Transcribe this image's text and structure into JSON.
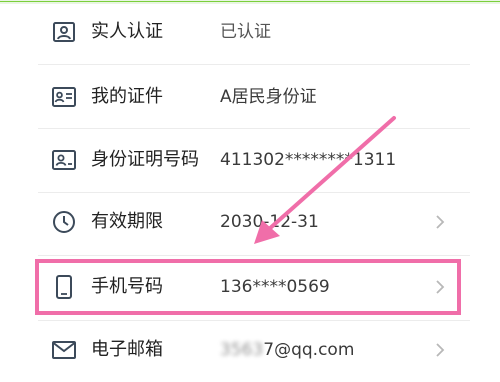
{
  "rows": [
    {
      "label": "实人认证",
      "value": "已认证",
      "icon": "person-id-icon",
      "has_chevron": false
    },
    {
      "label": "我的证件",
      "value": "A居民身份证",
      "icon": "id-card-icon",
      "has_chevron": false
    },
    {
      "label": "身份证明号码",
      "value": "411302********1311",
      "icon": "id-number-icon",
      "has_chevron": false
    },
    {
      "label": "有效期限",
      "value": "2030-12-31",
      "icon": "clock-icon",
      "has_chevron": true
    },
    {
      "label": "手机号码",
      "value": "136****0569",
      "icon": "phone-icon",
      "has_chevron": true
    },
    {
      "label": "电子邮箱",
      "value_visible": "7@qq.com",
      "value_blurred": "3563",
      "icon": "mail-icon",
      "has_chevron": true
    }
  ],
  "colors": {
    "highlight": "#f06ea9",
    "arrow": "#f06ea9",
    "icon": "#3c4a5a",
    "chevron": "#b8b8b8"
  },
  "annotation": {
    "highlighted_row": "手机号码"
  }
}
